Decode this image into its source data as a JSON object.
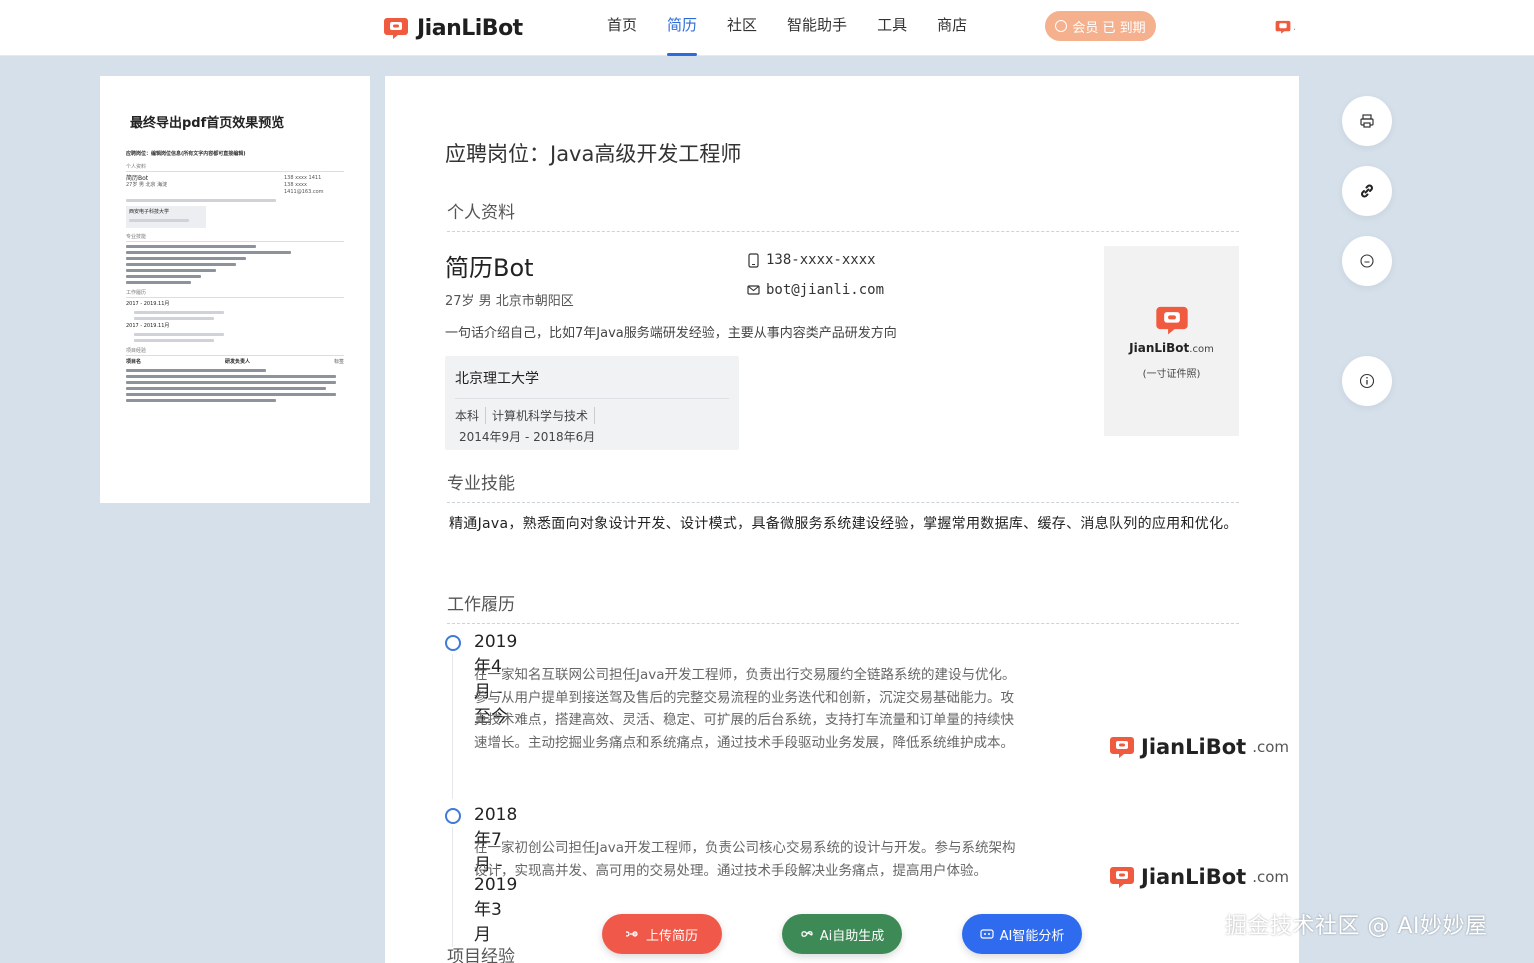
{
  "header": {
    "brand": "JianLiBot",
    "nav": [
      "首页",
      "简历",
      "社区",
      "智能助手",
      "工具",
      "商店"
    ],
    "active_nav": "简历",
    "member_label": "会员 已 到期",
    "user_dot": "."
  },
  "preview": {
    "title": "最终导出pdf首页效果预览",
    "job_line": "应聘岗位：编辑岗位信息(所有文字内容都可直接编辑)",
    "personal_label": "个人资料",
    "name": "简历Bot",
    "meta": "27岁 男 北京 海淀",
    "phone": "138 xxxx 1411",
    "email": "138 xxxx 1411@163.com",
    "school": "西安电子科技大学",
    "skills_label": "专业技能",
    "work_label": "工作履历",
    "date1": "2017 - 2019.11月",
    "date2": "2017 - 2019.11月",
    "project_label": "项目经验",
    "project_name": "项目名",
    "project_role": "研发负责人",
    "project_tag": "标签"
  },
  "resume": {
    "job_title": "应聘岗位：Java高级开发工程师",
    "section_personal": "个人资料",
    "name": "简历Bot",
    "meta": "27岁 男 北京市朝阳区",
    "phone": "138-xxxx-xxxx",
    "email": "bot@jianli.com",
    "intro": "一句话介绍自己，比如7年Java服务端研发经验，主要从事内容类产品研发方向",
    "school": "北京理工大学",
    "degree": "本科",
    "major": "计算机科学与技术",
    "edu_date": "2014年9月 - 2018年6月",
    "photo_brand": "JianLiBot",
    "photo_domain": ".com",
    "photo_caption": "(一寸证件照)",
    "section_skills": "专业技能",
    "skills": "精通Java，熟悉面向对象设计开发、设计模式，具备微服务系统建设经验，掌握常用数据库、缓存、消息队列的应用和优化。",
    "section_work": "工作履历",
    "work": [
      {
        "date": "2019年4月 - 至今",
        "desc": "在一家知名互联网公司担任Java开发工程师，负责出行交易履约全链路系统的建设与优化。参与从用户提单到接送驾及售后的完整交易流程的业务迭代和创新，沉淀交易基础能力。攻克技术难点，搭建高效、灵活、稳定、可扩展的后台系统，支持打车流量和订单量的持续快速增长。主动挖掘业务痛点和系统痛点，通过技术手段驱动业务发展，降低系统维护成本。"
      },
      {
        "date": "2018年7月 - 2019年3月",
        "desc": "在一家初创公司担任Java开发工程师，负责公司核心交易系统的设计与开发。参与系统架构设计，实现高并发、高可用的交易处理。通过技术手段解决业务痛点，提高用户体验。"
      }
    ],
    "work_brand": "JianLiBot",
    "work_domain": ".com",
    "section_project": "项目经验"
  },
  "actions": {
    "upload": "上传简历",
    "generate": "Ai自助生成",
    "analyze": "AI智能分析"
  },
  "tools": [
    "printer-icon",
    "link-icon",
    "comment-icon",
    "info-icon"
  ],
  "watermark": "掘金技术社区 @ AI妙妙屋",
  "colors": {
    "brand_red": "#f05a3f",
    "nav_active": "#2f6bd8",
    "member_bg": "#f5b08e",
    "upload_bg": "#f0594a",
    "generate_bg": "#3d8a57",
    "analyze_bg": "#2f6bef"
  }
}
